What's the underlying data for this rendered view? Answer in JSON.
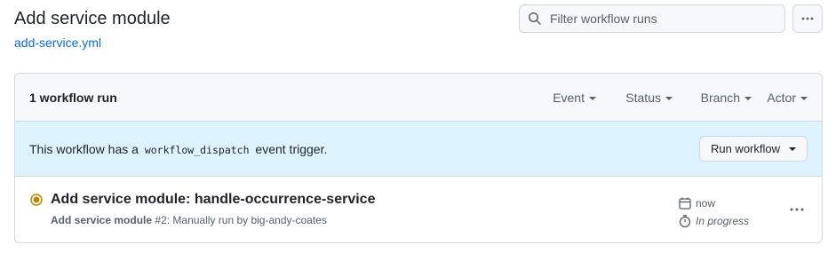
{
  "page": {
    "title": "Add service module",
    "file_link": "add-service.yml"
  },
  "search": {
    "placeholder": "Filter workflow runs",
    "value": ""
  },
  "list": {
    "run_count_label": "1 workflow run",
    "filters": [
      "Event",
      "Status",
      "Branch",
      "Actor"
    ],
    "dispatch": {
      "text_before": "This workflow has a",
      "code": "workflow_dispatch",
      "text_after": "event trigger.",
      "run_button_label": "Run workflow"
    },
    "runs": [
      {
        "title": "Add service module: handle-occurrence-service",
        "workflow_name": "Add service module",
        "run_number": "#2",
        "trigger_text": ": Manually run by big-andy-coates",
        "time": "now",
        "duration": "In progress",
        "status": "in-progress"
      }
    ]
  },
  "colors": {
    "link": "#0969da",
    "dispatch_bg": "#ddf4ff",
    "header_bg": "#f6f8fa",
    "in_progress": "#bf8700",
    "border": "#d0d7de"
  },
  "icons": {
    "search": "search-icon",
    "kebab": "kebab-horizontal-icon",
    "calendar": "calendar-icon",
    "stopwatch": "stopwatch-icon",
    "status": "in-progress-dot-icon"
  }
}
